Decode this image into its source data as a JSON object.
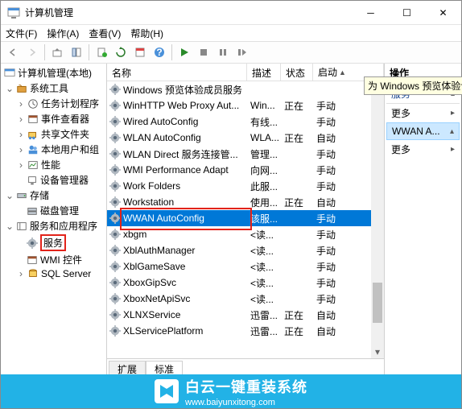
{
  "window": {
    "title": "计算机管理"
  },
  "menu": {
    "file": "文件(F)",
    "action": "操作(A)",
    "view": "查看(V)",
    "help": "帮助(H)"
  },
  "tree": {
    "root": "计算机管理(本地)",
    "system_tools": "系统工具",
    "task_scheduler": "任务计划程序",
    "event_viewer": "事件查看器",
    "shared_folders": "共享文件夹",
    "local_users": "本地用户和组",
    "performance": "性能",
    "device_manager": "设备管理器",
    "storage": "存储",
    "disk_management": "磁盘管理",
    "services_apps": "服务和应用程序",
    "services": "服务",
    "wmi": "WMI 控件",
    "sql": "SQL Server"
  },
  "columns": {
    "name": "名称",
    "desc": "描述",
    "status": "状态",
    "startup": "启动"
  },
  "rows": [
    {
      "name": "Windows 预览体验成员服务",
      "desc": "",
      "status": "",
      "startup": ""
    },
    {
      "name": "WinHTTP Web Proxy Aut...",
      "desc": "Win...",
      "status": "正在",
      "startup": "手动"
    },
    {
      "name": "Wired AutoConfig",
      "desc": "有线...",
      "status": "",
      "startup": "手动"
    },
    {
      "name": "WLAN AutoConfig",
      "desc": "WLA...",
      "status": "正在",
      "startup": "自动"
    },
    {
      "name": "WLAN Direct 服务连接管...",
      "desc": "管理...",
      "status": "",
      "startup": "手动"
    },
    {
      "name": "WMI Performance Adapt",
      "desc": "向网...",
      "status": "",
      "startup": "手动"
    },
    {
      "name": "Work Folders",
      "desc": "此服...",
      "status": "",
      "startup": "手动"
    },
    {
      "name": "Workstation",
      "desc": "使用...",
      "status": "正在",
      "startup": "自动"
    },
    {
      "name": "WWAN AutoConfig",
      "desc": "该服...",
      "status": "",
      "startup": "手动"
    },
    {
      "name": "xbgm",
      "desc": "<读...",
      "status": "",
      "startup": "手动"
    },
    {
      "name": "XblAuthManager",
      "desc": "<读...",
      "status": "",
      "startup": "手动"
    },
    {
      "name": "XblGameSave",
      "desc": "<读...",
      "status": "",
      "startup": "手动"
    },
    {
      "name": "XboxGipSvc",
      "desc": "<读...",
      "status": "",
      "startup": "手动"
    },
    {
      "name": "XboxNetApiSvc",
      "desc": "<读...",
      "status": "",
      "startup": "手动"
    },
    {
      "name": "XLNXService",
      "desc": "迅雷...",
      "status": "正在",
      "startup": "自动"
    },
    {
      "name": "XLServicePlatform",
      "desc": "迅雷...",
      "status": "正在",
      "startup": "自动"
    }
  ],
  "tooltip": "为 Windows 预览体验计划提供基础结构支持。",
  "tabs": {
    "extended": "扩展",
    "standard": "标准"
  },
  "right": {
    "header": "操作",
    "more1": "更多",
    "selected": "WWAN A...",
    "more2": "更多"
  },
  "footer": {
    "brand": "白云一键重装系统",
    "url": "www.baiyunxitong.com"
  }
}
